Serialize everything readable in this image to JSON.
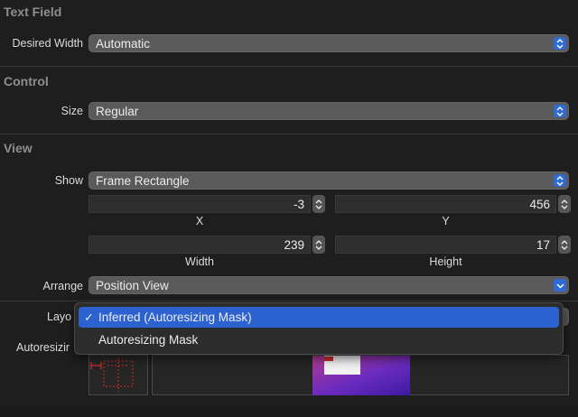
{
  "text_field": {
    "title": "Text Field",
    "desired_width_label": "Desired Width",
    "desired_width_value": "Automatic"
  },
  "control": {
    "title": "Control",
    "size_label": "Size",
    "size_value": "Regular"
  },
  "view": {
    "title": "View",
    "show_label": "Show",
    "show_value": "Frame Rectangle",
    "x_value": "-3",
    "x_label": "X",
    "y_value": "456",
    "y_label": "Y",
    "width_value": "239",
    "width_label": "Width",
    "height_value": "17",
    "height_label": "Height",
    "arrange_label": "Arrange",
    "arrange_value": "Position View",
    "layout_label_partial": "Layo",
    "autoresizing_label_partial": "Autoresizir"
  },
  "layout_menu": {
    "items": [
      {
        "label": "Inferred (Autoresizing Mask)",
        "checked": true
      },
      {
        "label": "Autoresizing Mask",
        "checked": false
      }
    ],
    "check_glyph": "✓"
  },
  "colors": {
    "accent": "#2b62d0",
    "background": "#1e1e1e",
    "popup": "#5a5a5a",
    "preview_purple": "#6a2bbf",
    "autoresize_red": "#d12a2a"
  },
  "icons": {
    "popup_arrows": "up-down-chevron-icon",
    "stepper": "stepper-icon",
    "dropdown": "chevron-down-icon"
  }
}
